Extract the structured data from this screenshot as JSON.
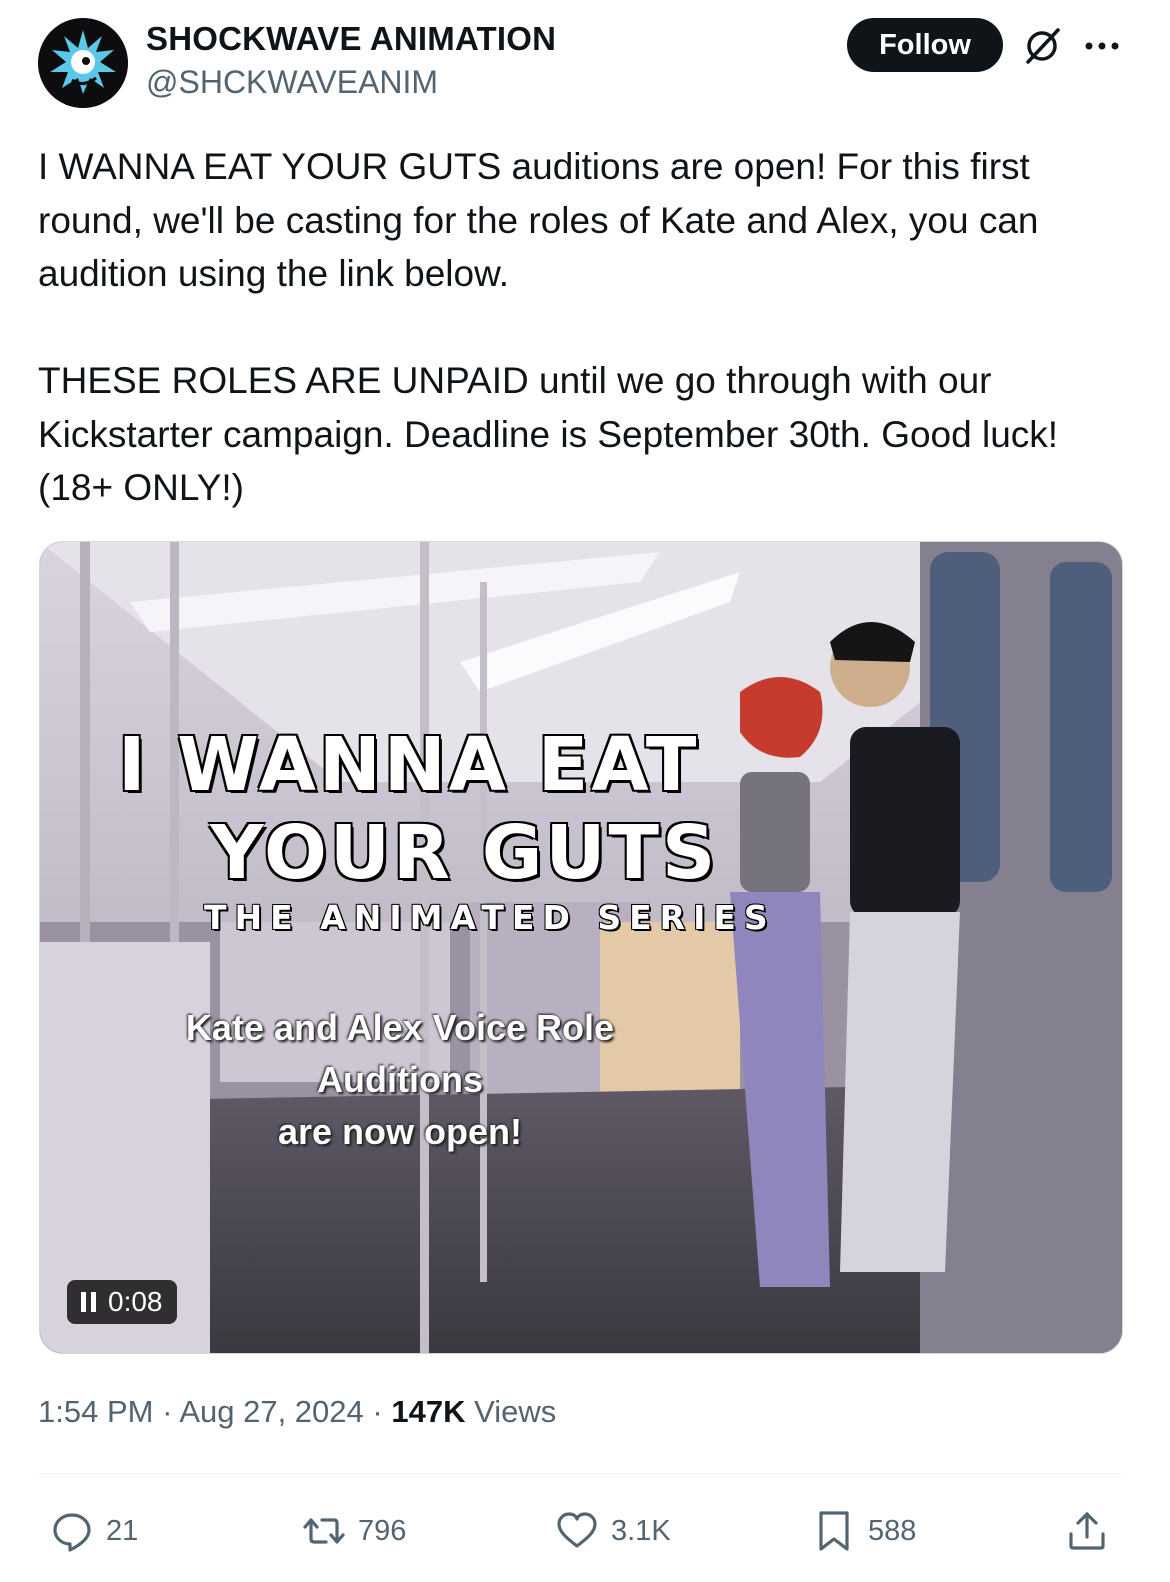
{
  "author": {
    "name": "SHOCKWAVE ANIMATION",
    "handle": "@SHCKWAVEANIM"
  },
  "follow_label": "Follow",
  "post": {
    "paragraphs": [
      "I WANNA EAT YOUR GUTS auditions are open! For this first round, we'll be casting for the roles of Kate and Alex, you can audition using the link below.",
      "THESE ROLES ARE UNPAID until we go through with our Kickstarter campaign. Deadline is September 30th. Good luck! (18+ ONLY!)"
    ]
  },
  "media": {
    "title_line1": "I WANNA EAT",
    "title_line2": "YOUR GUTS",
    "title_line3": "THE ANIMATED SERIES",
    "subtitle_line1": "Kate and Alex Voice Role Auditions",
    "subtitle_line2": "are now open!",
    "timestamp": "0:08",
    "state": "playing"
  },
  "meta": {
    "time": "1:54 PM",
    "separator": "·",
    "date": "Aug 27, 2024",
    "views_count": "147K",
    "views_label": "Views"
  },
  "actions": {
    "replies": "21",
    "reposts": "796",
    "likes": "3.1K",
    "bookmarks": "588"
  },
  "icons": [
    "grok-icon",
    "more-icon",
    "pause-icon",
    "reply-icon",
    "repost-icon",
    "like-icon",
    "bookmark-icon",
    "share-icon"
  ],
  "colors": {
    "text": "#0f1419",
    "secondary": "#536471",
    "follow_bg": "#0f1419",
    "border": "#cfd9de"
  }
}
